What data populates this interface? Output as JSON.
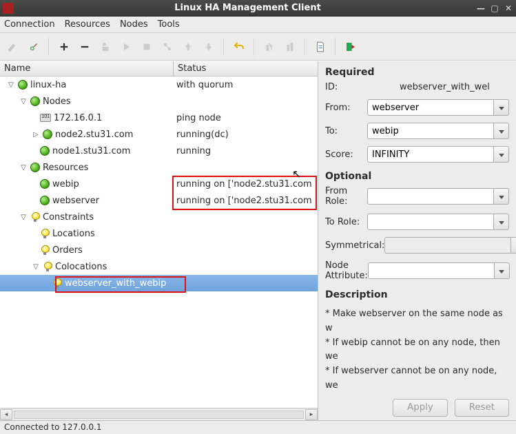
{
  "window": {
    "title": "Linux HA Management Client"
  },
  "menu": {
    "connection": "Connection",
    "resources": "Resources",
    "nodes": "Nodes",
    "tools": "Tools"
  },
  "columns": {
    "name": "Name",
    "status": "Status"
  },
  "tree": {
    "root": {
      "label": "linux-ha",
      "status": "with quorum"
    },
    "nodes": {
      "label": "Nodes",
      "items": [
        {
          "label": "172.16.0.1",
          "status": "ping node",
          "icon": "chip"
        },
        {
          "label": "node2.stu31.com",
          "status": "running(dc)",
          "icon": "green",
          "expandable": true
        },
        {
          "label": "node1.stu31.com",
          "status": "running",
          "icon": "green"
        }
      ]
    },
    "resources": {
      "label": "Resources",
      "items": [
        {
          "label": "webip",
          "status": "running on ['node2.stu31.com"
        },
        {
          "label": "webserver",
          "status": "running on ['node2.stu31.com"
        }
      ]
    },
    "constraints": {
      "label": "Constraints",
      "locations": {
        "label": "Locations"
      },
      "orders": {
        "label": "Orders"
      },
      "colocations": {
        "label": "Colocations",
        "items": [
          {
            "label": "webserver_with_webip"
          }
        ]
      }
    }
  },
  "properties": {
    "required": {
      "title": "Required",
      "id_label": "ID:",
      "id_value": "webserver_with_wel",
      "from_label": "From:",
      "from_value": "webserver",
      "to_label": "To:",
      "to_value": "webip",
      "score_label": "Score:",
      "score_value": "INFINITY"
    },
    "optional": {
      "title": "Optional",
      "from_role_label": "From Role:",
      "from_role_value": "",
      "to_role_label": "To Role:",
      "to_role_value": "",
      "symmetrical_label": "Symmetrical:",
      "symmetrical_value": "",
      "node_attribute_label": "Node Attribute:",
      "node_attribute_value": ""
    },
    "description": {
      "title": "Description",
      "lines": [
        "* Make webserver  on the same node as w",
        "* If webip cannot be  on any node, then we",
        "* If webserver cannot be  on any node, we"
      ]
    },
    "apply": "Apply",
    "reset": "Reset"
  },
  "statusbar": "Connected to 127.0.0.1"
}
